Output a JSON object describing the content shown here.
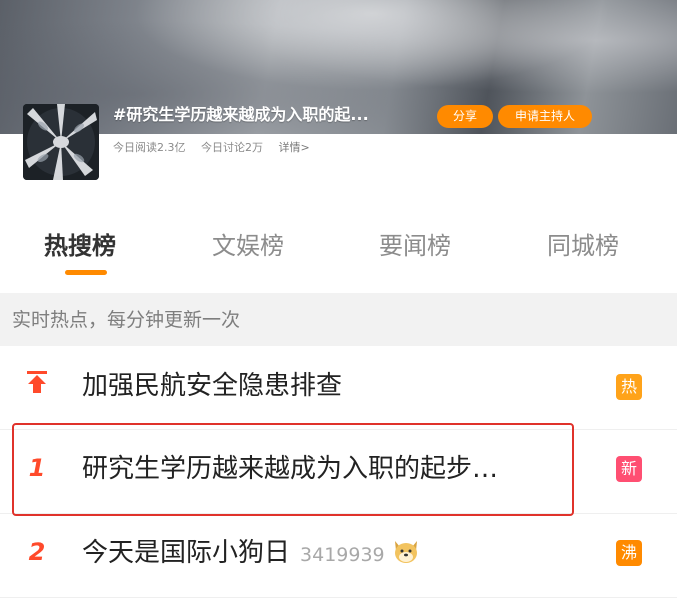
{
  "topic": {
    "title": "#研究生学历越来越成为入职的起...",
    "share_label": "分享",
    "host_label": "申请主持人",
    "reads": "今日阅读2.3亿",
    "discussions": "今日讨论2万",
    "detail": "详情>"
  },
  "tabs": [
    {
      "label": "热搜榜",
      "active": true
    },
    {
      "label": "文娱榜",
      "active": false
    },
    {
      "label": "要闻榜",
      "active": false
    },
    {
      "label": "同城榜",
      "active": false
    }
  ],
  "subheader": "实时热点，每分钟更新一次",
  "rows": [
    {
      "rank": "",
      "rank_icon": "pin-top-icon",
      "text": "加强民航安全隐患排查",
      "count": "",
      "badge": "热",
      "badge_type": "hot"
    },
    {
      "rank": "1",
      "text": "研究生学历越来越成为入职的起步…",
      "count": "",
      "badge": "新",
      "badge_type": "new"
    },
    {
      "rank": "2",
      "text": "今天是国际小狗日",
      "count": "3419939",
      "emoji": "dog-face-icon",
      "badge": "沸",
      "badge_type": "boil"
    }
  ],
  "colors": {
    "accent": "#ff8a00",
    "rank_red": "#ff4a2b",
    "badge_hot": "#ffa31a",
    "badge_new": "#ff4f72",
    "badge_boil": "#ff8a00",
    "highlight_border": "#e0322b"
  }
}
